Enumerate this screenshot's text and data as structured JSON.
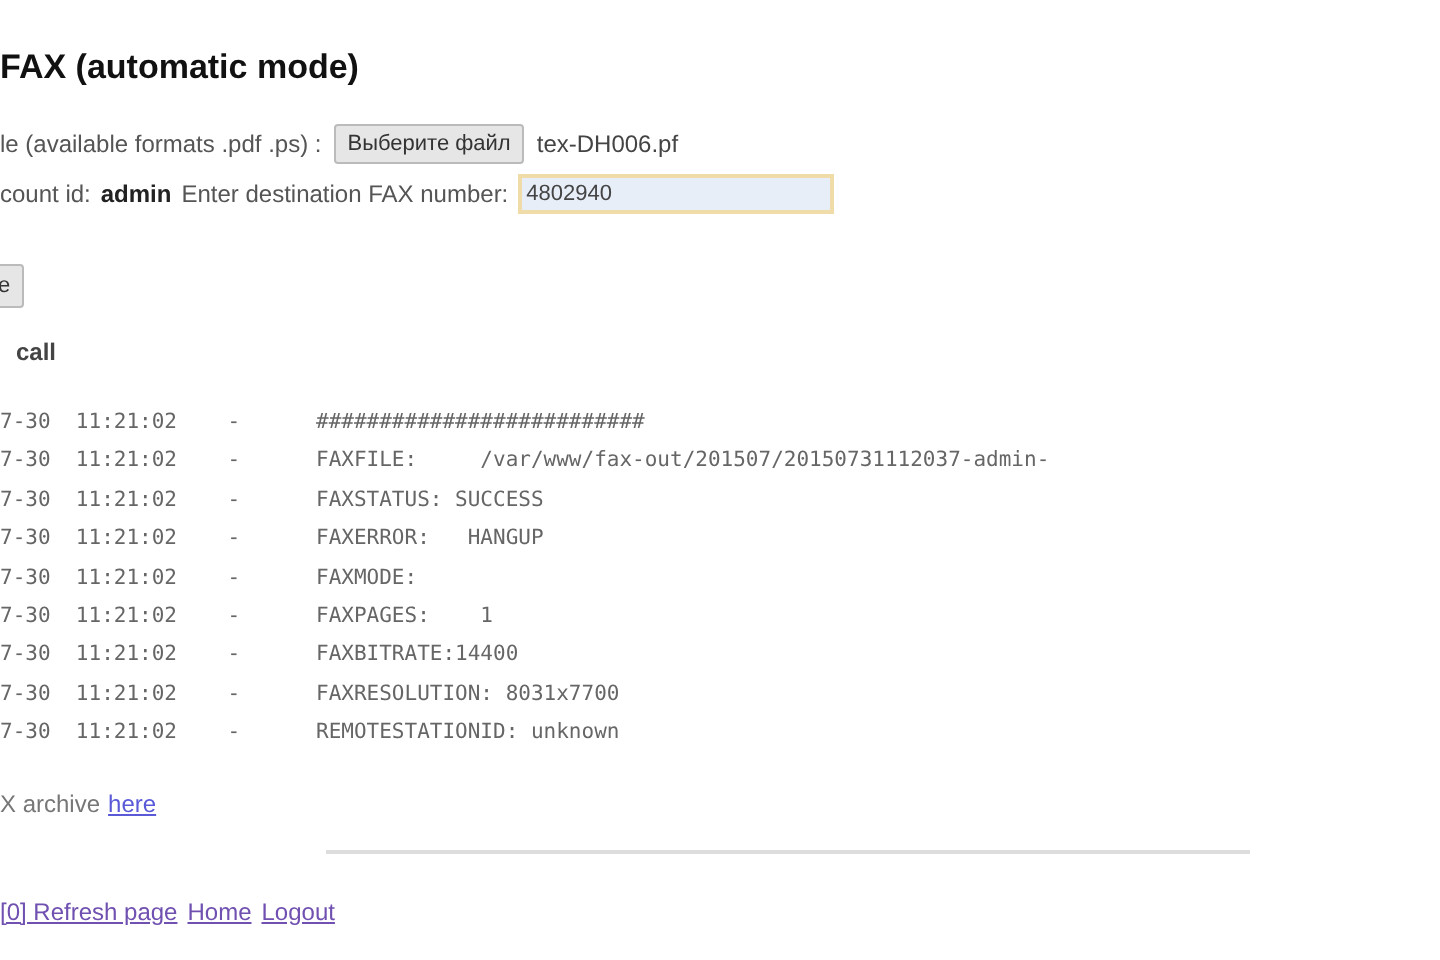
{
  "title": "FAX (automatic mode)",
  "file_row": {
    "label": "le (available formats .pdf .ps) :",
    "button": "Выберите файл",
    "file_name": "tex-DH006.pf"
  },
  "account_row": {
    "label": "count id:",
    "account": "admin",
    "prompt": "Enter destination FAX number:",
    "fax_number": "4802940"
  },
  "send_button": "e",
  "log_heading": "call",
  "log": [
    {
      "time": "7-30  11:21:02    -",
      "text": "##########################"
    },
    {
      "time": "7-30  11:21:02    -",
      "text": "FAXFILE:     /var/www/fax-out/201507/20150731112037-admin-"
    },
    {
      "time": "7-30  11:21:02    -",
      "text": "FAXSTATUS: SUCCESS"
    },
    {
      "time": "7-30  11:21:02    -",
      "text": "FAXERROR:   HANGUP"
    },
    {
      "time": "7-30  11:21:02    -",
      "text": "FAXMODE:"
    },
    {
      "time": "7-30  11:21:02    -",
      "text": "FAXPAGES:    1"
    },
    {
      "time": "7-30  11:21:02    -",
      "text": "FAXBITRATE:14400"
    },
    {
      "time": "7-30  11:21:02    -",
      "text": "FAXRESOLUTION: 8031x7700"
    },
    {
      "time": "7-30  11:21:02    -",
      "text": "REMOTESTATIONID: unknown"
    }
  ],
  "archive": {
    "text": "X archive",
    "link": "here"
  },
  "footer_links": [
    "[0] Refresh page",
    "Home",
    "Logout"
  ]
}
